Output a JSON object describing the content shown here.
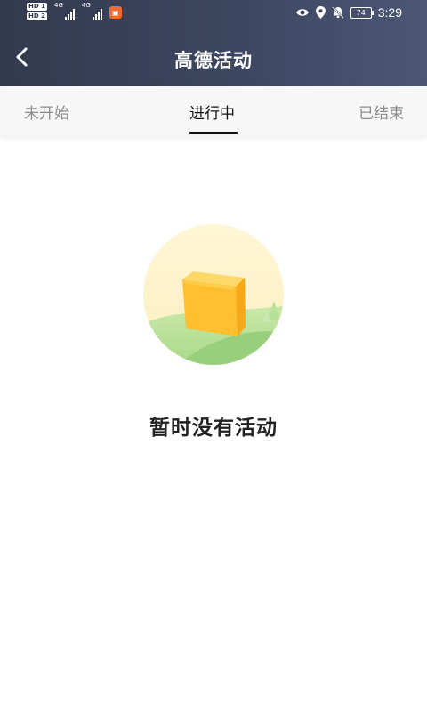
{
  "status_bar": {
    "sim1": "HD 1",
    "sim2": "HD 2",
    "network1": "4G",
    "network2": "4G",
    "battery": "74",
    "time": "3:29",
    "icons": [
      "eye-icon",
      "location-icon",
      "bell-off-icon"
    ]
  },
  "nav": {
    "title": "高德活动",
    "back_icon": "chevron-left-icon"
  },
  "tabs": [
    {
      "label": "未开始",
      "active": false
    },
    {
      "label": "进行中",
      "active": true
    },
    {
      "label": "已结束",
      "active": false
    }
  ],
  "empty_state": {
    "message": "暂时没有活动",
    "illustration": "empty-box-illustration"
  }
}
